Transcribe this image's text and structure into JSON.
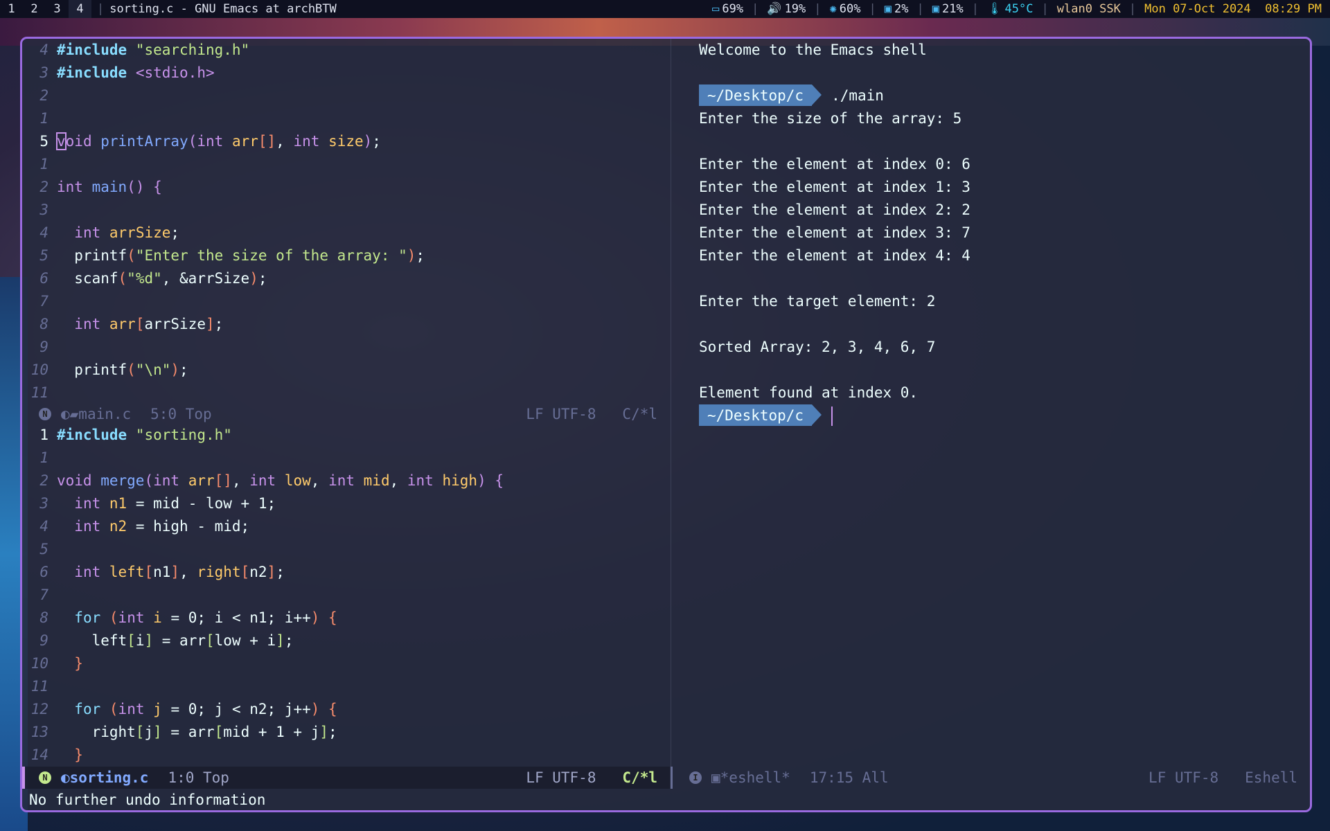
{
  "topbar": {
    "workspaces": [
      "1",
      "2",
      "3",
      "4"
    ],
    "active_workspace": "4",
    "title": "sorting.c - GNU Emacs at archBTW",
    "stats": [
      {
        "icon": "battery-icon",
        "glyph": "▭",
        "value": "69%",
        "color": "#e0e4f0"
      },
      {
        "icon": "volume-icon",
        "glyph": "🔊",
        "value": "19%",
        "color": "#e0e4f0"
      },
      {
        "icon": "brightness-icon",
        "glyph": "✺",
        "value": "60%",
        "color": "#e0e4f0"
      },
      {
        "icon": "cpu-icon",
        "glyph": "▣",
        "value": "2%",
        "color": "#e0e4f0"
      },
      {
        "icon": "memory-icon",
        "glyph": "▣",
        "value": "21%",
        "color": "#e0e4f0"
      },
      {
        "icon": "temperature-icon",
        "glyph": "🌡",
        "value": "45°C",
        "color": "#3ad0f0"
      },
      {
        "icon": "",
        "glyph": "",
        "value": "wlan0 SSK",
        "color": "#e8c89a"
      },
      {
        "icon": "",
        "glyph": "",
        "value": "Mon 07-Oct 2024  08:29 PM",
        "color": "#f0c030"
      }
    ]
  },
  "top_buffer": {
    "lines": [
      {
        "n": "4",
        "t": [
          [
            "inc",
            "#include"
          ],
          [
            "txt",
            " "
          ],
          [
            "str",
            "\"searching.h\""
          ]
        ]
      },
      {
        "n": "3",
        "t": [
          [
            "inc",
            "#include"
          ],
          [
            "txt",
            " "
          ],
          [
            "sys",
            "<stdio.h>"
          ]
        ]
      },
      {
        "n": "2",
        "t": []
      },
      {
        "n": "1",
        "t": []
      },
      {
        "n": "5",
        "cur": true,
        "t": [
          [
            "kw cursor",
            "v"
          ],
          [
            "kw",
            "oid"
          ],
          [
            "txt",
            " "
          ],
          [
            "fn",
            "printArray"
          ],
          [
            "kw",
            "("
          ],
          [
            "kw",
            "int"
          ],
          [
            "txt",
            " "
          ],
          [
            "var",
            "arr"
          ],
          [
            "br",
            "[]"
          ],
          [
            "txt",
            ", "
          ],
          [
            "kw",
            "int"
          ],
          [
            "txt",
            " "
          ],
          [
            "var",
            "size"
          ],
          [
            "kw",
            ")"
          ],
          [
            "txt",
            ";"
          ]
        ]
      },
      {
        "n": "1",
        "t": []
      },
      {
        "n": "2",
        "t": [
          [
            "kw",
            "int"
          ],
          [
            "txt",
            " "
          ],
          [
            "fn",
            "main"
          ],
          [
            "kw",
            "()"
          ],
          [
            "txt",
            " "
          ],
          [
            "kw",
            "{"
          ]
        ]
      },
      {
        "n": "3",
        "t": []
      },
      {
        "n": "4",
        "t": [
          [
            "txt",
            "  "
          ],
          [
            "kw",
            "int"
          ],
          [
            "txt",
            " "
          ],
          [
            "var",
            "arrSize"
          ],
          [
            "txt",
            ";"
          ]
        ]
      },
      {
        "n": "5",
        "t": [
          [
            "txt",
            "  printf"
          ],
          [
            "br",
            "("
          ],
          [
            "str",
            "\"Enter the size of the array: \""
          ],
          [
            "br",
            ")"
          ],
          [
            "txt",
            ";"
          ]
        ]
      },
      {
        "n": "6",
        "t": [
          [
            "txt",
            "  scanf"
          ],
          [
            "br",
            "("
          ],
          [
            "str",
            "\"%d\""
          ],
          [
            "txt",
            ", &arrSize"
          ],
          [
            "br",
            ")"
          ],
          [
            "txt",
            ";"
          ]
        ]
      },
      {
        "n": "7",
        "t": []
      },
      {
        "n": "8",
        "t": [
          [
            "txt",
            "  "
          ],
          [
            "kw",
            "int"
          ],
          [
            "txt",
            " "
          ],
          [
            "var",
            "arr"
          ],
          [
            "br",
            "["
          ],
          [
            "txt",
            "arrSize"
          ],
          [
            "br",
            "]"
          ],
          [
            "txt",
            ";"
          ]
        ]
      },
      {
        "n": "9",
        "t": []
      },
      {
        "n": "10",
        "t": [
          [
            "txt",
            "  printf"
          ],
          [
            "br",
            "("
          ],
          [
            "str",
            "\"\\n\""
          ],
          [
            "br",
            ")"
          ],
          [
            "txt",
            ";"
          ]
        ]
      },
      {
        "n": "11",
        "t": []
      }
    ],
    "modeline": {
      "state": "N",
      "buffer": "main.c",
      "position": "5:0 Top",
      "encoding": "LF UTF-8",
      "mode": "C/*l"
    }
  },
  "bottom_buffer": {
    "lines": [
      {
        "n": "1",
        "cur": true,
        "t": [
          [
            "inc",
            "#include"
          ],
          [
            "txt",
            " "
          ],
          [
            "str",
            "\"sorting.h\""
          ]
        ]
      },
      {
        "n": "1",
        "t": []
      },
      {
        "n": "2",
        "t": [
          [
            "kw",
            "void"
          ],
          [
            "txt",
            " "
          ],
          [
            "fn",
            "merge"
          ],
          [
            "kw",
            "("
          ],
          [
            "kw",
            "int"
          ],
          [
            "txt",
            " "
          ],
          [
            "var",
            "arr"
          ],
          [
            "br",
            "[]"
          ],
          [
            "txt",
            ", "
          ],
          [
            "kw",
            "int"
          ],
          [
            "txt",
            " "
          ],
          [
            "var",
            "low"
          ],
          [
            "txt",
            ", "
          ],
          [
            "kw",
            "int"
          ],
          [
            "txt",
            " "
          ],
          [
            "var",
            "mid"
          ],
          [
            "txt",
            ", "
          ],
          [
            "kw",
            "int"
          ],
          [
            "txt",
            " "
          ],
          [
            "var",
            "high"
          ],
          [
            "kw",
            ")"
          ],
          [
            "txt",
            " "
          ],
          [
            "kw",
            "{"
          ]
        ]
      },
      {
        "n": "3",
        "t": [
          [
            "txt",
            "  "
          ],
          [
            "kw",
            "int"
          ],
          [
            "txt",
            " "
          ],
          [
            "var",
            "n1"
          ],
          [
            "txt",
            " = mid - low + 1;"
          ]
        ]
      },
      {
        "n": "4",
        "t": [
          [
            "txt",
            "  "
          ],
          [
            "kw",
            "int"
          ],
          [
            "txt",
            " "
          ],
          [
            "var",
            "n2"
          ],
          [
            "txt",
            " = high - mid;"
          ]
        ]
      },
      {
        "n": "5",
        "t": []
      },
      {
        "n": "6",
        "t": [
          [
            "txt",
            "  "
          ],
          [
            "kw",
            "int"
          ],
          [
            "txt",
            " "
          ],
          [
            "var",
            "left"
          ],
          [
            "br",
            "["
          ],
          [
            "txt",
            "n1"
          ],
          [
            "br",
            "]"
          ],
          [
            "txt",
            ", "
          ],
          [
            "var",
            "right"
          ],
          [
            "br",
            "["
          ],
          [
            "txt",
            "n2"
          ],
          [
            "br",
            "]"
          ],
          [
            "txt",
            ";"
          ]
        ]
      },
      {
        "n": "7",
        "t": []
      },
      {
        "n": "8",
        "t": [
          [
            "txt",
            "  "
          ],
          [
            "ctl",
            "for"
          ],
          [
            "txt",
            " "
          ],
          [
            "br",
            "("
          ],
          [
            "kw",
            "int"
          ],
          [
            "txt",
            " "
          ],
          [
            "var",
            "i"
          ],
          [
            "txt",
            " = 0; i < n1; i++"
          ],
          [
            "br",
            ")"
          ],
          [
            "txt",
            " "
          ],
          [
            "br",
            "{"
          ]
        ]
      },
      {
        "n": "9",
        "t": [
          [
            "txt",
            "    left"
          ],
          [
            "br2",
            "["
          ],
          [
            "txt",
            "i"
          ],
          [
            "br2",
            "]"
          ],
          [
            "txt",
            " = arr"
          ],
          [
            "br2",
            "["
          ],
          [
            "txt",
            "low + i"
          ],
          [
            "br2",
            "]"
          ],
          [
            "txt",
            ";"
          ]
        ]
      },
      {
        "n": "10",
        "t": [
          [
            "txt",
            "  "
          ],
          [
            "br",
            "}"
          ]
        ]
      },
      {
        "n": "11",
        "t": []
      },
      {
        "n": "12",
        "t": [
          [
            "txt",
            "  "
          ],
          [
            "ctl",
            "for"
          ],
          [
            "txt",
            " "
          ],
          [
            "br",
            "("
          ],
          [
            "kw",
            "int"
          ],
          [
            "txt",
            " "
          ],
          [
            "var",
            "j"
          ],
          [
            "txt",
            " = 0; j < n2; j++"
          ],
          [
            "br",
            ")"
          ],
          [
            "txt",
            " "
          ],
          [
            "br",
            "{"
          ]
        ]
      },
      {
        "n": "13",
        "t": [
          [
            "txt",
            "    right"
          ],
          [
            "br2",
            "["
          ],
          [
            "txt",
            "j"
          ],
          [
            "br2",
            "]"
          ],
          [
            "txt",
            " = arr"
          ],
          [
            "br2",
            "["
          ],
          [
            "txt",
            "mid + 1 + j"
          ],
          [
            "br2",
            "]"
          ],
          [
            "txt",
            ";"
          ]
        ]
      },
      {
        "n": "14",
        "t": [
          [
            "txt",
            "  "
          ],
          [
            "br",
            "}"
          ]
        ]
      }
    ],
    "modeline": {
      "state": "N",
      "buffer": "sorting.c",
      "position": "1:0 Top",
      "encoding": "LF UTF-8",
      "mode": "C/*l"
    }
  },
  "eshell": {
    "welcome": "Welcome to the Emacs shell",
    "prompt": "~/Desktop/c",
    "command": "./main",
    "output": [
      "Enter the size of the array: 5",
      "",
      "Enter the element at index 0: 6",
      "Enter the element at index 1: 3",
      "Enter the element at index 2: 2",
      "Enter the element at index 3: 7",
      "Enter the element at index 4: 4",
      "",
      "Enter the target element: 2",
      "",
      "Sorted Array: 2, 3, 4, 6, 7",
      "",
      "Element found at index 0."
    ],
    "modeline": {
      "state": "I",
      "buffer": "*eshell*",
      "position": "17:15 All",
      "encoding": "LF UTF-8",
      "mode": "Eshell"
    }
  },
  "echo_area": "No further undo information"
}
